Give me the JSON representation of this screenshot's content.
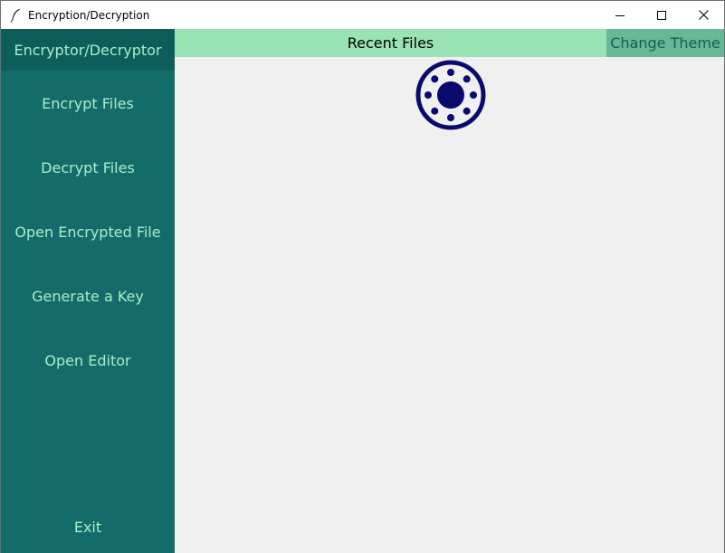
{
  "window": {
    "title": "Encryption/Decryption",
    "app_icon": "feather-icon",
    "controls": [
      "minimize-icon",
      "maximize-icon",
      "close-icon"
    ]
  },
  "sidebar": {
    "header": "Encryptor/Decryptor",
    "items": [
      {
        "label": "Encrypt Files"
      },
      {
        "label": "Decrypt Files"
      },
      {
        "label": "Open Encrypted File"
      },
      {
        "label": "Generate a Key"
      },
      {
        "label": "Open Editor"
      }
    ],
    "exit_label": "Exit"
  },
  "topbar": {
    "title": "Recent Files",
    "theme_button_label": "Change Theme"
  },
  "main": {
    "loader_icon": "loading-spinner-icon"
  },
  "colors": {
    "sidebar_bg": "#146c6a",
    "sidebar_header_bg": "#0d5e5b",
    "sidebar_text": "#a8edc8",
    "topbar_bg": "#9ae3b5",
    "theme_button_bg": "#68b896",
    "theme_button_text": "#145e57",
    "content_bg": "#f0f0f0",
    "loader": "#0a0a6e"
  }
}
